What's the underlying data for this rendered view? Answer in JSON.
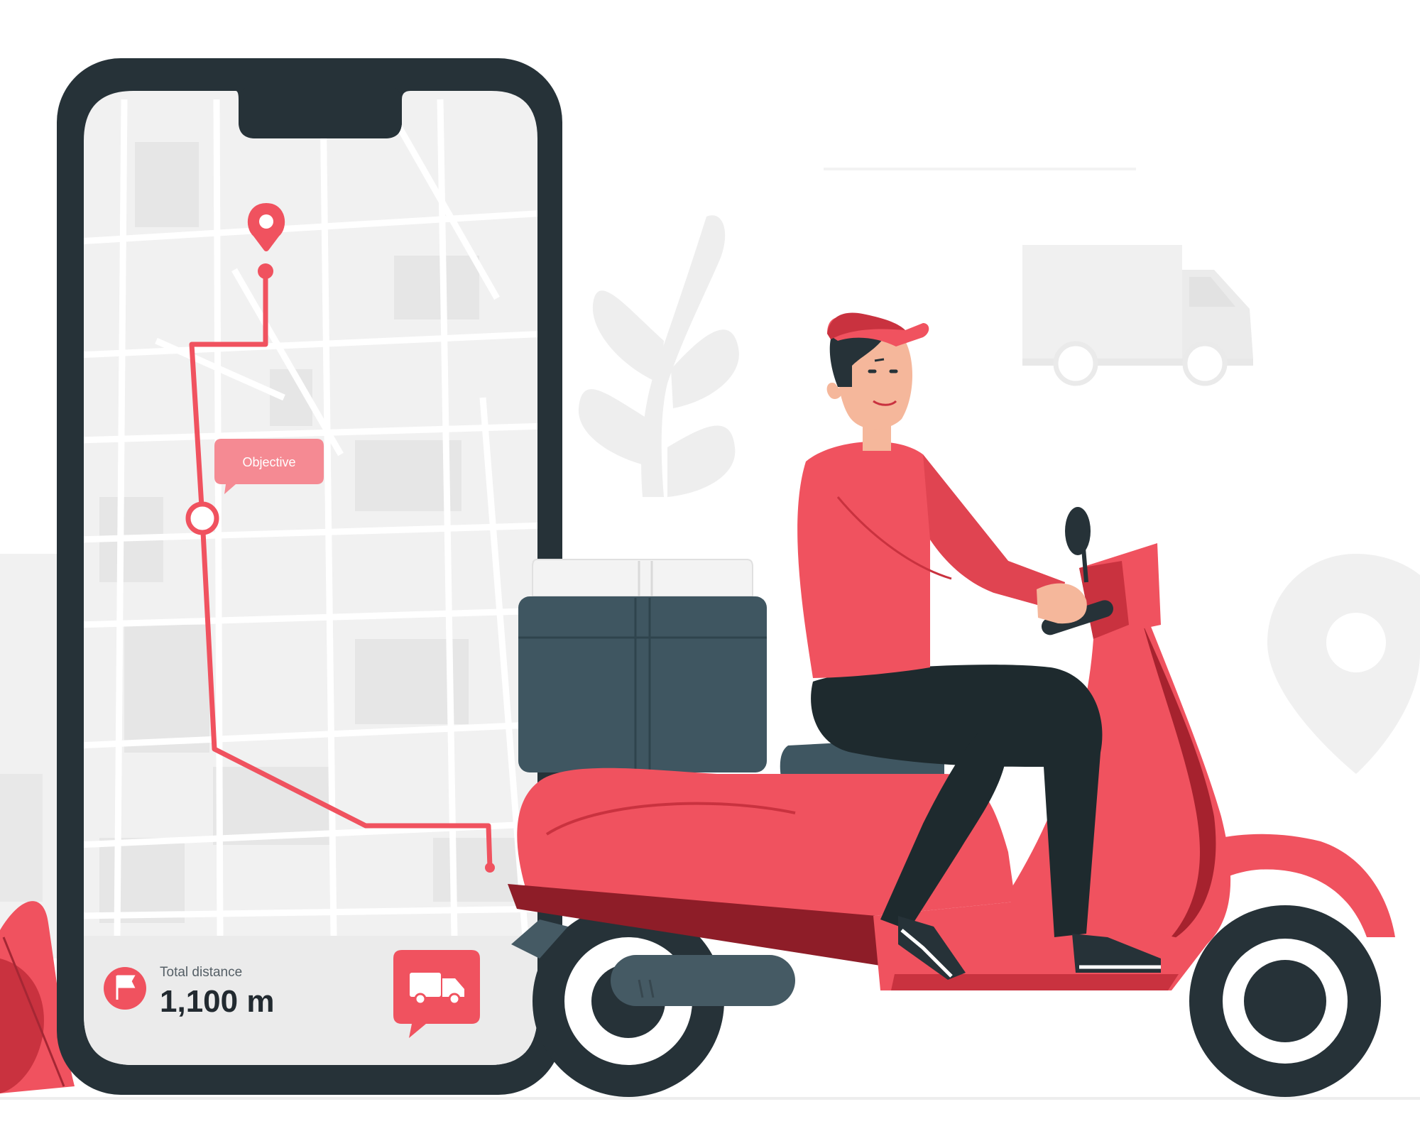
{
  "map": {
    "objective_label": "Objective"
  },
  "summary": {
    "distance_caption": "Total distance",
    "distance_value": "1,100 m"
  },
  "icons": {
    "destination": "map-pin-icon",
    "waypoint": "waypoint-ring-icon",
    "flag": "flag-icon",
    "truck": "delivery-truck-icon"
  },
  "colors": {
    "accent": "#f0525f",
    "dark": "#263238",
    "map_bg": "#f1f1f1",
    "roads": "#ffffff",
    "background_art": "#ebebeb",
    "box": "#3f5661",
    "trouser": "#1e2a2e"
  }
}
